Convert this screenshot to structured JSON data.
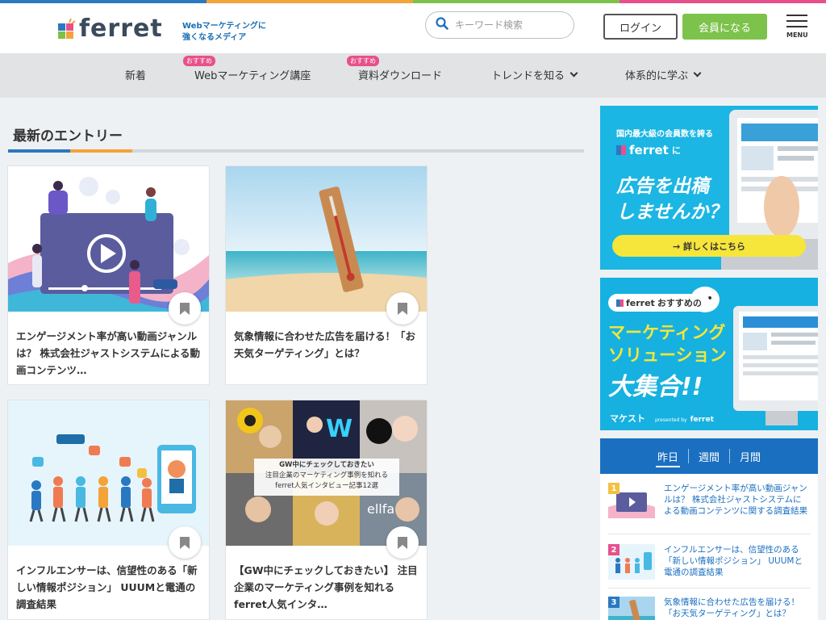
{
  "colors": {
    "top_bar": [
      "#2a78c2",
      "#f4a23a",
      "#7cc14a",
      "#e8508b"
    ],
    "accent_blue": "#1a6fc0",
    "join_green": "#7dc24b",
    "badge_pink": "#e8508b"
  },
  "header": {
    "logo_text": "ferret",
    "tagline_line1": "Webマーケティングに",
    "tagline_line2": "強くなるメディア",
    "search_placeholder": "キーワード検索",
    "login_label": "ログイン",
    "join_label": "会員になる",
    "menu_label": "MENU"
  },
  "nav": {
    "items": [
      {
        "label": "新着",
        "badge": ""
      },
      {
        "label": "Webマーケティング講座",
        "badge": "おすすめ"
      },
      {
        "label": "資料ダウンロード",
        "badge": "おすすめ"
      },
      {
        "label": "トレンドを知る",
        "badge": ""
      },
      {
        "label": "体系的に学ぶ",
        "badge": ""
      }
    ]
  },
  "main": {
    "section_title": "最新のエントリー",
    "cards": [
      {
        "title": "エンゲージメント率が高い動画ジャンルは？ 株式会社ジャストシステムによる動画コンテンツ…"
      },
      {
        "title": "気象情報に合わせた広告を届ける！「お天気ターゲティング」とは？"
      },
      {
        "title": "インフルエンサーは、信望性のある「新しい情報ポジション」 UUUMと電通の調査結果"
      },
      {
        "title": "【GW中にチェックしておきたい】 注目企業のマーケティング事例を知れるferret人気インタ…"
      }
    ],
    "card4_overlay_line1": "GW中にチェックしておきたい",
    "card4_overlay_line2": "注目企業のマーケティング事例を知れる",
    "card4_overlay_line3": "ferret人気インタビュー記事12選"
  },
  "sidebar": {
    "ad1": {
      "line1": "国内最大級の会員数を誇る",
      "brand": "ferret",
      "brand_suffix": "に",
      "headline1": "広告を出稿",
      "headline2": "しませんか？",
      "cta": "→ 詳しくはこちら"
    },
    "ad2": {
      "brand": "ferret",
      "brand_suffix": "おすすめの",
      "headline1": "マーケティング",
      "headline2": "ソリューション",
      "headline3": "大集合!!",
      "footer_logo": "マケスト",
      "footer_presented": "presented by",
      "footer_brand": "ferret"
    },
    "ranking": {
      "tabs": [
        "昨日",
        "週間",
        "月間"
      ],
      "items": [
        {
          "rank": "1",
          "title": "エンゲージメント率が高い動画ジャンルは？ 株式会社ジャストシステムによる動画コンテンツに関する調査結果"
        },
        {
          "rank": "2",
          "title": "インフルエンサーは、信望性のある「新しい情報ポジション」 UUUMと電通の調査結果"
        },
        {
          "rank": "3",
          "title": "気象情報に合わせた広告を届ける！「お天気ターゲティング」とは？"
        }
      ]
    }
  }
}
